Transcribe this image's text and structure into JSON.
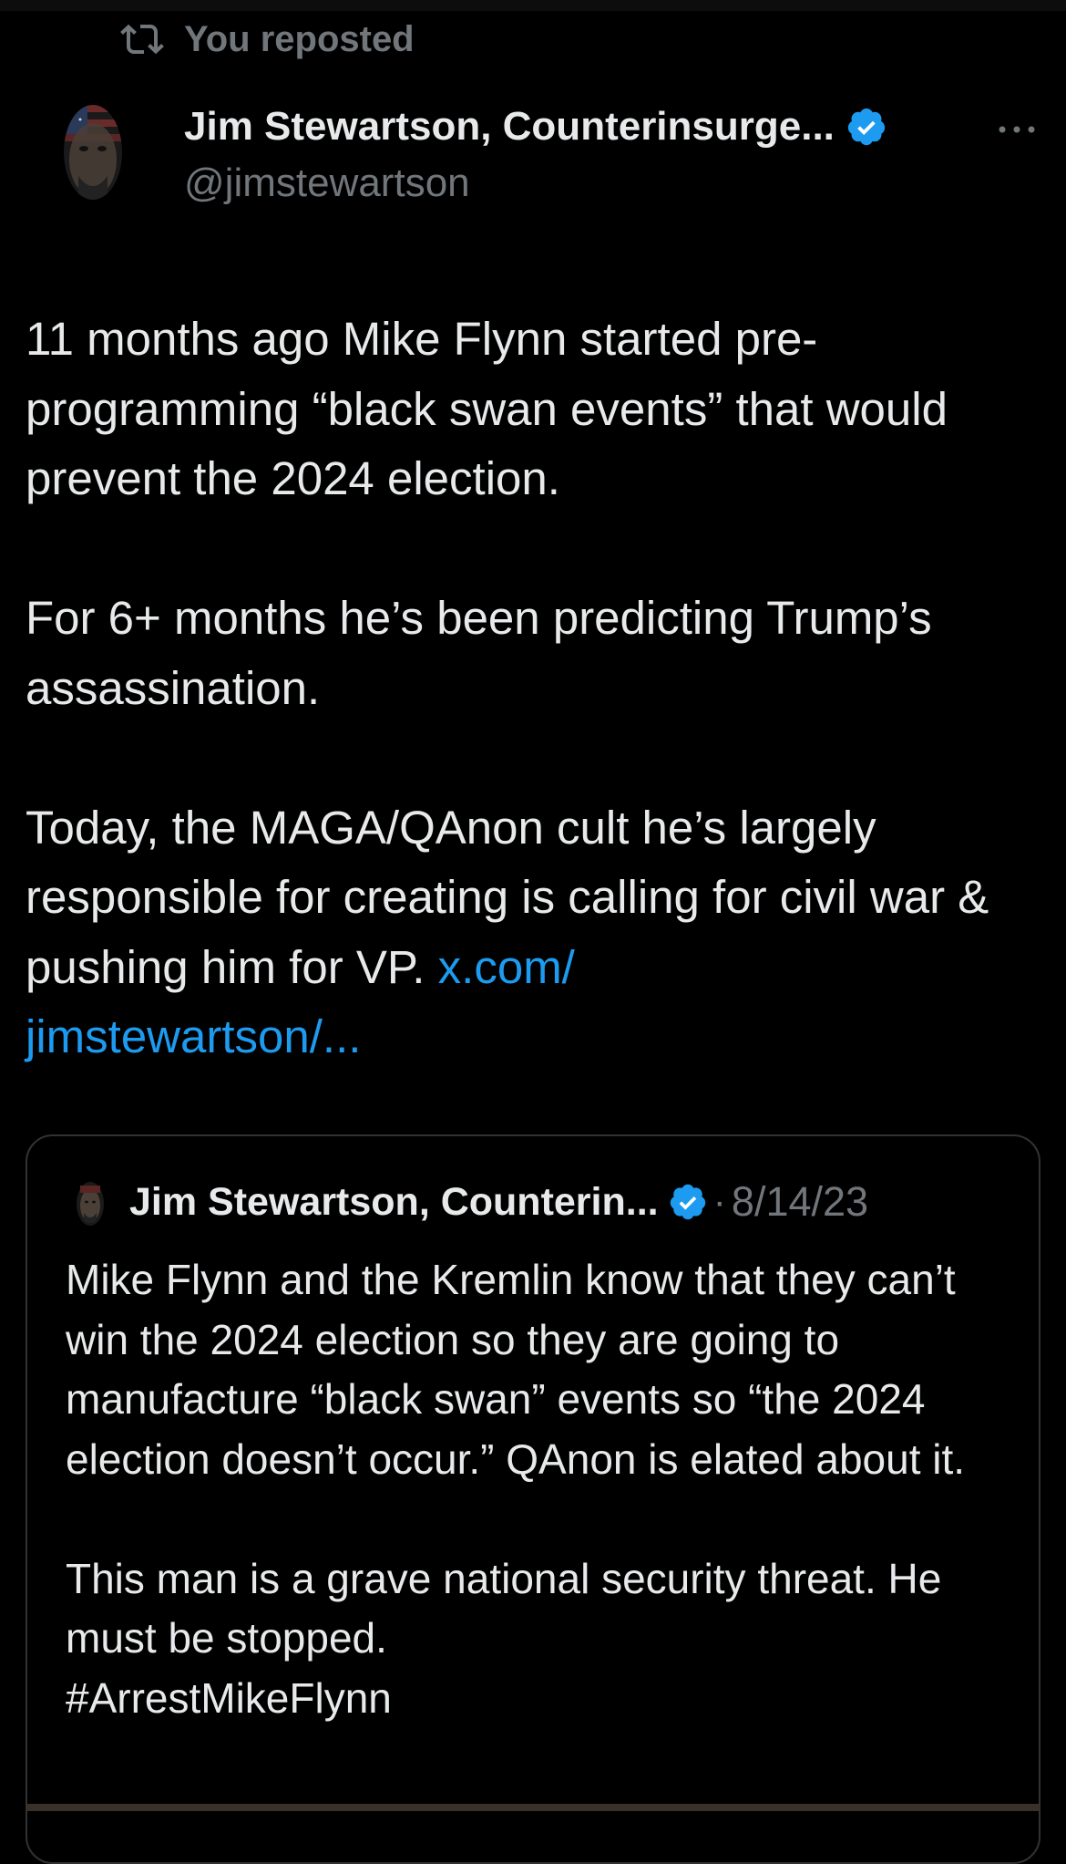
{
  "repost": {
    "label": "You reposted",
    "icon": "repost-icon"
  },
  "tweet": {
    "author": {
      "display_name": "Jim Stewartson, Counterinsurge...",
      "handle": "@jimstewartson",
      "verified": true,
      "verified_color": "#1d9bf0"
    },
    "more_icon": "more-dots-icon",
    "paragraphs": [
      "11 months ago Mike Flynn started pre-programming “black swan events” that would prevent the 2024 election.",
      "For 6+ months he’s been predicting Trump’s assassination."
    ],
    "paragraph3_text": "Today, the MAGA/QAnon cult he’s largely responsible for creating is calling for civil war & pushing him for VP. ",
    "link_text": "x.com/\njimstewartson/...",
    "link_color": "#1d9bf0"
  },
  "quote": {
    "author": {
      "display_name": "Jim Stewartson, Counterin...",
      "verified": true
    },
    "separator": "·",
    "date": "8/14/23",
    "paragraphs": [
      "Mike Flynn and the Kremlin know that they can’t win the 2024 election so they are going to manufacture “black swan” events so “the 2024 election doesn’t occur.” QAnon is elated about it.",
      "This man is a grave national security threat. He must be stopped.\n#ArrestMikeFlynn"
    ]
  },
  "colors": {
    "background": "#000000",
    "text": "#e7e9ea",
    "muted": "#71767b",
    "accent": "#1d9bf0",
    "border": "#2f3336"
  }
}
